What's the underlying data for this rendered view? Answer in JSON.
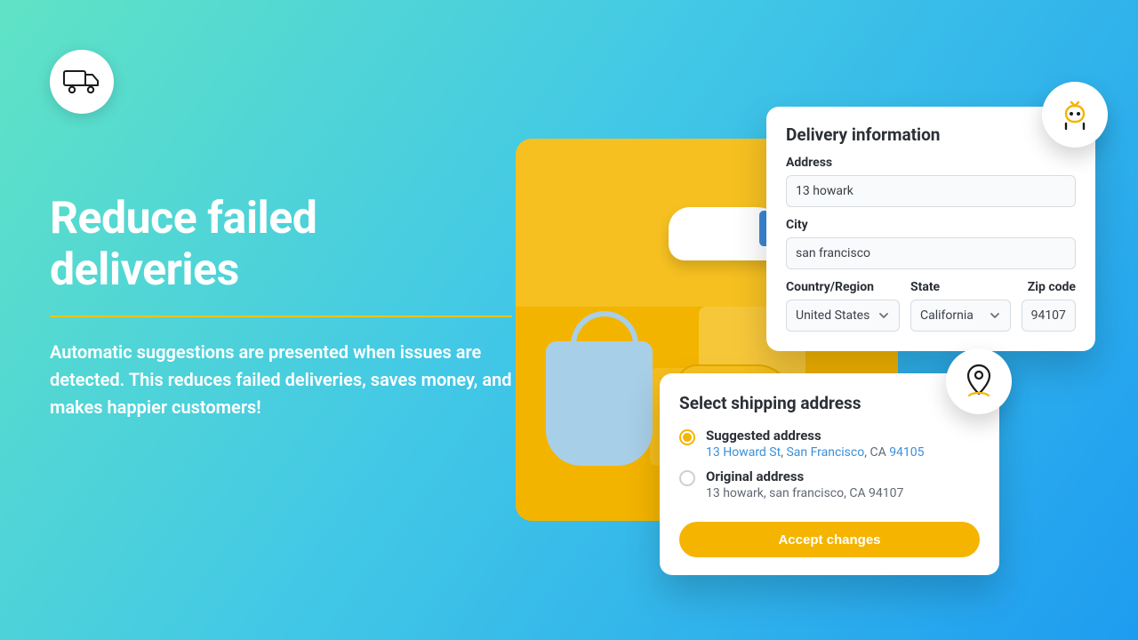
{
  "hero": {
    "title": "Reduce failed deliveries",
    "body": "Automatic suggestions are presented when issues are detected. This reduces failed deliveries, saves money, and makes happier customers!"
  },
  "delivery": {
    "heading": "Delivery information",
    "address_label": "Address",
    "address_value": "13 howark",
    "city_label": "City",
    "city_value": "san francisco",
    "country_label": "Country/Region",
    "country_value": "United States",
    "state_label": "State",
    "state_value": "California",
    "zip_label": "Zip code",
    "zip_value": "94107"
  },
  "shipping": {
    "heading": "Select shipping address",
    "suggested_label": "Suggested address",
    "suggested_parts": {
      "street": "13 Howard St",
      "city": "San Francisco",
      "state": "CA",
      "zip": "94105"
    },
    "original_label": "Original address",
    "original_value": "13 howark, san francisco, CA 94107",
    "accept_label": "Accept changes"
  }
}
